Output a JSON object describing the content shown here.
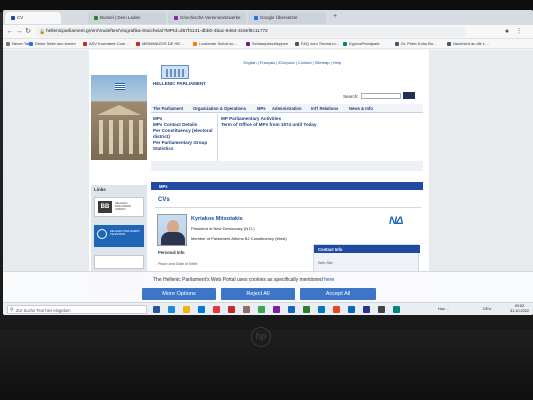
{
  "browser": {
    "tabs": [
      {
        "label": "CV",
        "color": "#1f4aa0",
        "active": true
      },
      {
        "label": "Bunsel | Dein Laden",
        "color": "#2e7d32",
        "active": false
      },
      {
        "label": "Griechische Vereinsnetzwerke",
        "color": "#8e24aa",
        "active": false
      },
      {
        "label": "Google Übersetzer",
        "color": "#1a73e8",
        "active": false
      }
    ],
    "address": "hellenicparliament.gr/en/Vouleftes/Viografika-Stoicheia/?MPId=d67f4141-dbb0-4bac-9464-3c8ef8c11772",
    "bookmarks": [
      {
        "label": "Neuer Tab",
        "color": "#777"
      },
      {
        "label": "Deine Seite neu lernen",
        "color": "#1a73e8"
      },
      {
        "label": "ASV Koerdarte Com…",
        "color": "#c62828"
      },
      {
        "label": "MEIMMAZOS DE HE…",
        "color": "#c62828"
      },
      {
        "label": "Lockende Sofort so…",
        "color": "#f57c00"
      },
      {
        "label": "Schlampeschleppen",
        "color": "#6a1b9a"
      },
      {
        "label": "FAQ zum Thema m…",
        "color": "#555"
      },
      {
        "label": "KyprosPrivatpark",
        "color": "#00897b"
      },
      {
        "label": "Dr. Peter Kuhs Bu…",
        "color": "#455a64"
      },
      {
        "label": "Nachricht an die L…",
        "color": "#455a64"
      }
    ]
  },
  "site": {
    "util_links": "English | Français | Ελληνικά | Contact | Sitemap | Help",
    "logo_text": "HELLENIC PARLIAMENT",
    "search_label": "Search:",
    "menu": [
      "The Parliament",
      "Organization & Operations",
      "MPs",
      "Administration",
      "Int'l Relations",
      "News & Info"
    ],
    "sub_left": [
      "MPs",
      "MPs Contact Details",
      "Per Constituency (electoral district)",
      "Per Parliamentary Group",
      "Statistics"
    ],
    "sub_right": [
      "MP Parliamentary Activities",
      "Term of Office of MPs from 1974 until Today"
    ],
    "links_header": "Links",
    "library_text": "HELLENIC PARLIAMENT LIBRARY",
    "tv_text": "HELLENIC PARLIAMENT TELEVISION",
    "section_bar": "MPs",
    "cvs_title": "CVs",
    "mp_name": "Kyriakos Mitsotakis",
    "mp_role": "President of New Democracy (N.D.)",
    "mp_member": "Member of Parliament Athens B2 Constituency (West)",
    "party_logo": "ΝΔ",
    "personal_info": "Personal Info",
    "birth_line": "Place and Date of Birth:",
    "contact_info": "Contact Info",
    "contact_web": "Web Site:"
  },
  "cookie": {
    "text": "The Hellenic Parliament's Web Portal uses cookies as specifically mentioned",
    "link": "here",
    "more_options": "More Options",
    "reject_all": "Reject All",
    "accept_all": "Accept All"
  },
  "taskbar": {
    "search_placeholder": "Zur Suche Text hier eingeben",
    "apps": [
      "#2b579a",
      "#1e88e5",
      "#f4b400",
      "#0078d4",
      "#e53935",
      "#c62828",
      "#8d6e63",
      "#34a853",
      "#7b1fa2",
      "#1565c0",
      "#2e7d32",
      "#0277bd",
      "#e64a19",
      "#0a66c2",
      "#283593",
      "#424242",
      "#00897b"
    ],
    "weather": "Nac…",
    "lang": "DEU",
    "time": "09:52",
    "date": "31.10.2022"
  },
  "laptop_brand": "hp"
}
